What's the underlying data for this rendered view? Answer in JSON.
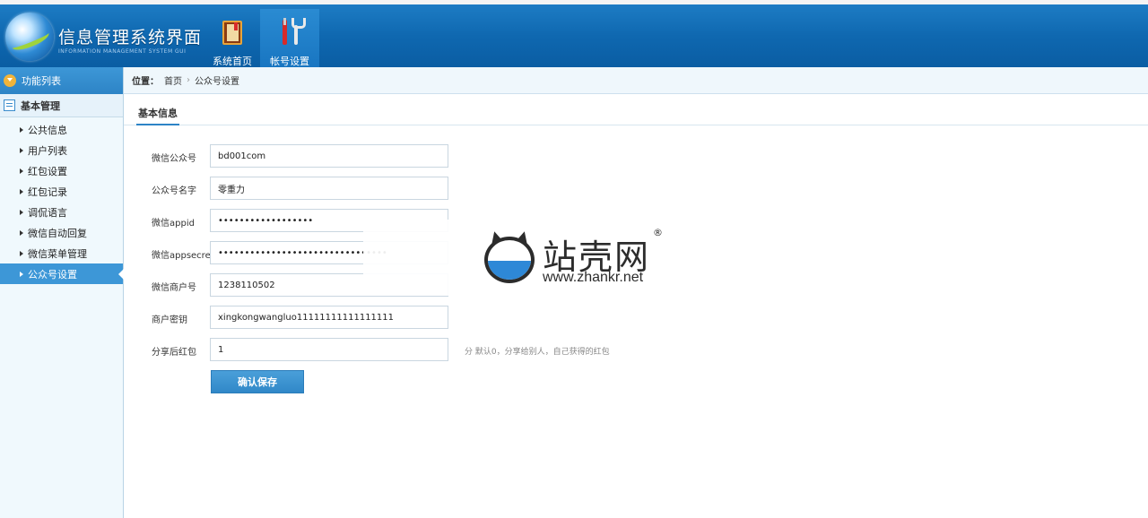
{
  "header": {
    "title": "信息管理系统界面",
    "subtitle": "INFORMATION MANAGEMENT SYSTEM GUI",
    "nav": [
      {
        "label": "系统首页",
        "icon": "book-icon",
        "active": false
      },
      {
        "label": "帐号设置",
        "icon": "tools-icon",
        "active": true
      }
    ]
  },
  "sidebar": {
    "heading": "功能列表",
    "group": "基本管理",
    "items": [
      {
        "label": "公共信息"
      },
      {
        "label": "用户列表"
      },
      {
        "label": "红包设置"
      },
      {
        "label": "红包记录"
      },
      {
        "label": "调侃语言"
      },
      {
        "label": "微信自动回复"
      },
      {
        "label": "微信菜单管理"
      },
      {
        "label": "公众号设置",
        "active": true
      }
    ]
  },
  "breadcrumb": {
    "prefix": "位置：",
    "items": [
      "首页",
      "公众号设置"
    ],
    "separator": "›"
  },
  "tab": {
    "label": "基本信息"
  },
  "form": {
    "fields": [
      {
        "label": "微信公众号",
        "value": "bd001com"
      },
      {
        "label": "公众号名字",
        "value": "零重力"
      },
      {
        "label": "微信appid",
        "value": "••••••••••••••••••"
      },
      {
        "label": "微信appsecret",
        "value": "••••••••••••••••••••••••••••••••"
      },
      {
        "label": "微信商户号",
        "value": "1238110502"
      },
      {
        "label": "商户密钥",
        "value": "xingkongwangluo11111111111111111"
      },
      {
        "label": "分享后红包",
        "value": "1",
        "hint": "分 默认0，分享给别人，自己获得的红包"
      }
    ],
    "submit_label": "确认保存"
  },
  "watermark": {
    "name": "站壳网",
    "registered": "®",
    "url": "www.zhankr.net"
  },
  "colors": {
    "header_bg": "#0f68b0",
    "accent": "#2d84c6",
    "active_underline": "#3cc51e",
    "sidebar_bg": "#f0f9fd"
  }
}
